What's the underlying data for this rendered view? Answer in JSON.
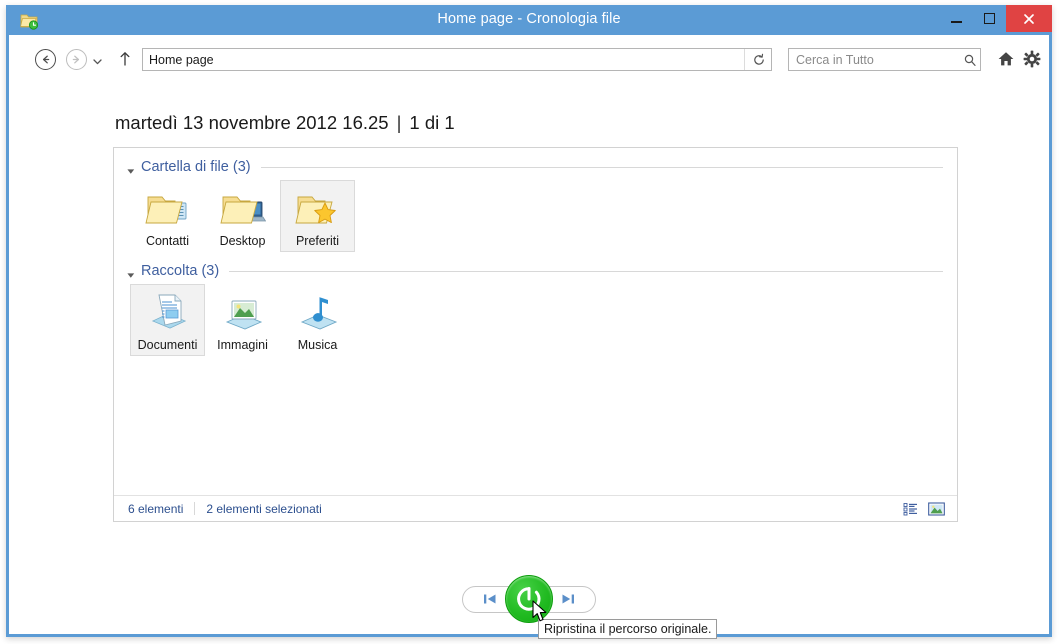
{
  "window": {
    "title": "Home page - Cronologia file",
    "app_icon": "file-history-folder-icon",
    "accent_color": "#5b9bd5",
    "close_color": "#e04343",
    "controls": {
      "minimize": "–",
      "maximize": "□",
      "close": "✕"
    }
  },
  "toolbar": {
    "back_icon": "back-arrow-icon",
    "forward_icon": "forward-arrow-icon",
    "recent_icon": "chevron-down-icon",
    "up_icon": "up-arrow-icon",
    "address_value": "Home page",
    "address_dropdown_icon": "chevron-down-icon",
    "refresh_icon": "refresh-icon",
    "search_placeholder": "Cerca in Tutto",
    "search_value": "",
    "search_icon": "search-icon",
    "home_icon": "home-icon",
    "settings_icon": "gear-icon"
  },
  "header": {
    "date": "martedì 13 novembre 2012 16.25",
    "separator": "|",
    "position": "1 di 1"
  },
  "groups": [
    {
      "label": "Cartella di file (3)",
      "collapse_icon": "triangle-collapse-icon",
      "items": [
        {
          "label": "Contatti",
          "icon": "folder-contacts-icon",
          "selected": false
        },
        {
          "label": "Desktop",
          "icon": "folder-desktop-icon",
          "selected": false
        },
        {
          "label": "Preferiti",
          "icon": "folder-favorites-icon",
          "selected": true
        }
      ]
    },
    {
      "label": "Raccolta (3)",
      "collapse_icon": "triangle-collapse-icon",
      "items": [
        {
          "label": "Documenti",
          "icon": "library-documents-icon",
          "selected": true
        },
        {
          "label": "Immagini",
          "icon": "library-pictures-icon",
          "selected": false
        },
        {
          "label": "Musica",
          "icon": "library-music-icon",
          "selected": false
        }
      ]
    }
  ],
  "status": {
    "item_count": "6 elementi",
    "selected_count": "2 elementi selezionati",
    "view_details_icon": "details-view-icon",
    "view_large_icons_icon": "large-icons-view-icon"
  },
  "bottom": {
    "previous_icon": "skip-previous-icon",
    "restore_icon": "restore-circular-arrow-icon",
    "next_icon": "skip-next-icon",
    "restore_color": "#22bb22"
  },
  "tooltip": {
    "text": "Ripristina il percorso originale."
  }
}
